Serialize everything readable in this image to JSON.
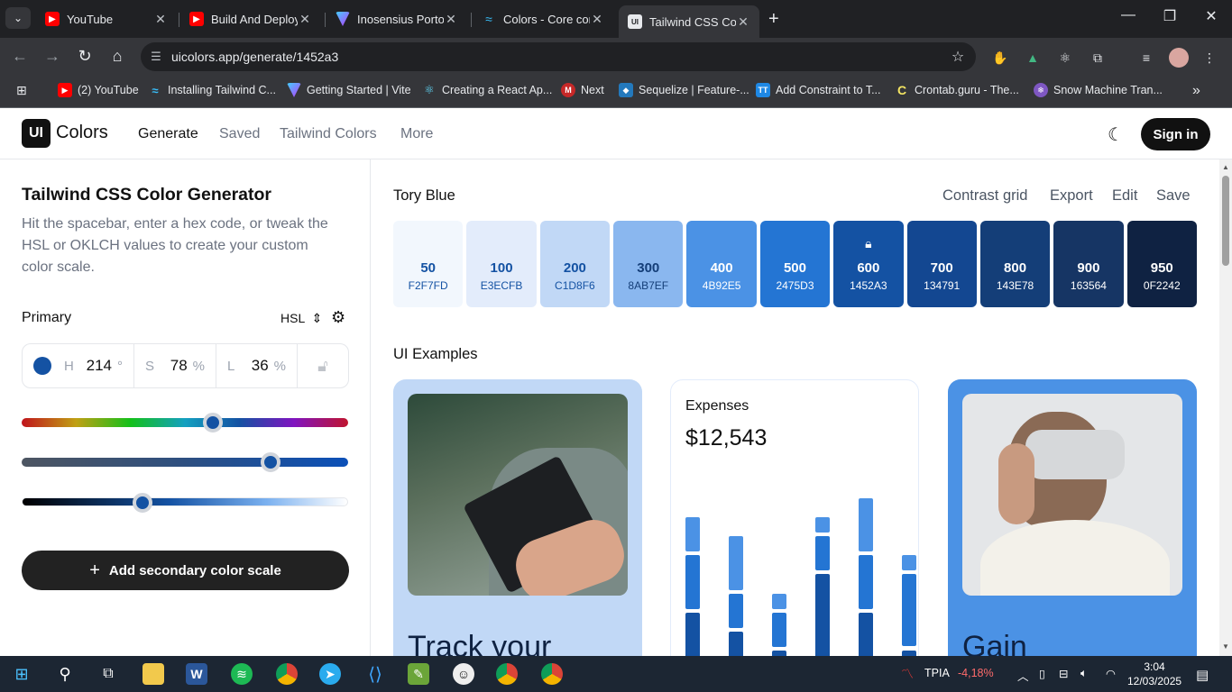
{
  "browser": {
    "tabs": [
      {
        "title": "YouTube",
        "icon": "youtube-icon",
        "active": false
      },
      {
        "title": "Build And Deploy",
        "icon": "youtube-icon",
        "active": false
      },
      {
        "title": "Inosensius Portof",
        "icon": "vite-icon",
        "active": false
      },
      {
        "title": "Colors - Core cor",
        "icon": "tailwind-icon",
        "active": false
      },
      {
        "title": "Tailwind CSS Colo",
        "icon": "uicolors-icon",
        "active": true
      }
    ],
    "url": "uicolors.app/generate/1452a3",
    "bookmarks": [
      {
        "title": "(2) YouTube",
        "icon": "youtube-icon"
      },
      {
        "title": "Installing Tailwind C...",
        "icon": "tailwind-icon"
      },
      {
        "title": "Getting Started | Vite",
        "icon": "vite-icon"
      },
      {
        "title": "Creating a React Ap...",
        "icon": "react-icon"
      },
      {
        "title": "Next",
        "icon": "m-icon"
      },
      {
        "title": "Sequelize | Feature-...",
        "icon": "sequelize-icon"
      },
      {
        "title": "Add Constraint to T...",
        "icon": "tt-icon"
      },
      {
        "title": "Crontab.guru - The...",
        "icon": "crontab-icon"
      },
      {
        "title": "Snow Machine Tran...",
        "icon": "snow-icon"
      }
    ]
  },
  "header": {
    "logo_mark": "UI",
    "logo_text": "Colors",
    "nav": [
      "Generate",
      "Saved",
      "Tailwind Colors",
      "More"
    ],
    "signin": "Sign in"
  },
  "generator": {
    "title": "Tailwind CSS Color Generator",
    "description": "Hit the spacebar, enter a hex code, or tweak the HSL or OKLCH values to create your custom color scale.",
    "primary_label": "Primary",
    "mode": "HSL",
    "h_label": "H",
    "h_value": "214",
    "h_unit": "°",
    "s_label": "S",
    "s_value": "78",
    "s_unit": "%",
    "l_label": "L",
    "l_value": "36",
    "l_unit": "%",
    "add_secondary": "Add secondary color scale",
    "hue_level": 0.59,
    "sat_level": 0.78,
    "light_level": 0.36
  },
  "scale": {
    "name": "Tory Blue",
    "actions": [
      "Contrast grid",
      "Export",
      "Edit",
      "Save"
    ],
    "swatches": [
      {
        "shade": "50",
        "hex": "F2F7FD",
        "color": "#f2f7fd",
        "text": "#1452a3"
      },
      {
        "shade": "100",
        "hex": "E3ECFB",
        "color": "#e3ecfb",
        "text": "#1452a3"
      },
      {
        "shade": "200",
        "hex": "C1D8F6",
        "color": "#c1d8f6",
        "text": "#1452a3"
      },
      {
        "shade": "300",
        "hex": "8AB7EF",
        "color": "#8ab7ef",
        "text": "#143e78"
      },
      {
        "shade": "400",
        "hex": "4B92E5",
        "color": "#4b92e5",
        "text": "#ffffff"
      },
      {
        "shade": "500",
        "hex": "2475D3",
        "color": "#2475d3",
        "text": "#ffffff"
      },
      {
        "shade": "600",
        "hex": "1452A3",
        "color": "#1452a3",
        "text": "#ffffff"
      },
      {
        "shade": "700",
        "hex": "134791",
        "color": "#134791",
        "text": "#ffffff"
      },
      {
        "shade": "800",
        "hex": "143E78",
        "color": "#143e78",
        "text": "#ffffff"
      },
      {
        "shade": "900",
        "hex": "163564",
        "color": "#163564",
        "text": "#ffffff"
      },
      {
        "shade": "950",
        "hex": "0F2242",
        "color": "#0f2242",
        "text": "#ffffff"
      }
    ]
  },
  "examples": {
    "title": "UI Examples",
    "card1_heading": "Track your",
    "expenses_title": "Expenses",
    "expenses_value": "$12,543",
    "card3_heading": "Gain"
  },
  "taskbar": {
    "stock_name": "TPIA",
    "stock_change": "-4,18%",
    "time": "3:04",
    "date": "12/03/2025"
  }
}
